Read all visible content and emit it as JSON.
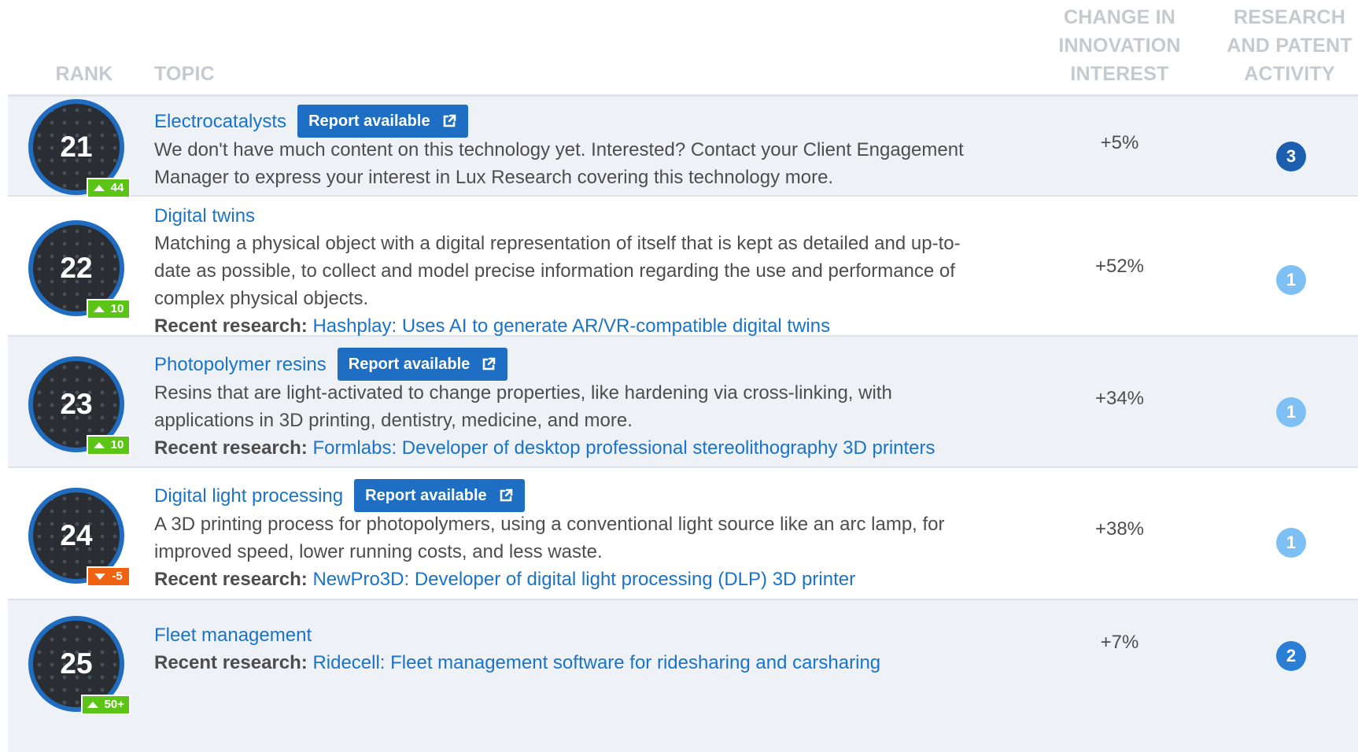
{
  "header": {
    "rank": "RANK",
    "topic": "TOPIC",
    "change": [
      "CHANGE IN",
      "INNOVATION",
      "INTEREST"
    ],
    "activity": [
      "RESEARCH",
      "AND PATENT",
      "ACTIVITY"
    ]
  },
  "rows": [
    {
      "rank": "21",
      "delta": "44",
      "delta_dir": "up",
      "title": "Electrocatalysts",
      "report": "Report available",
      "desc": [
        "We don't have much content on this technology yet. Interested? Contact your Client Engagement",
        "Manager to express your interest in Lux Research covering this technology more."
      ],
      "change": "+5%",
      "activity": "3"
    },
    {
      "rank": "22",
      "delta": "10",
      "delta_dir": "up",
      "title": "Digital twins",
      "desc": [
        "Matching a physical object with a digital representation of itself that is kept as detailed and up-to-",
        "date as possible, to collect and model precise information regarding the use and performance of",
        "complex physical objects."
      ],
      "recent_label": "Recent research:",
      "recent_link": "Hashplay: Uses AI to generate AR/VR-compatible digital twins",
      "change": "+52%",
      "activity": "1"
    },
    {
      "rank": "23",
      "delta": "10",
      "delta_dir": "up",
      "title": "Photopolymer resins",
      "report": "Report available",
      "desc": [
        "Resins that are light-activated to change properties, like hardening via cross-linking, with",
        "applications in 3D printing, dentistry, medicine, and more."
      ],
      "recent_label": "Recent research:",
      "recent_link": "Formlabs: Developer of desktop professional stereolithography 3D printers",
      "change": "+34%",
      "activity": "1"
    },
    {
      "rank": "24",
      "delta": "-5",
      "delta_dir": "down",
      "title": "Digital light processing",
      "report": "Report available",
      "desc": [
        "A 3D printing process for photopolymers, using a conventional light source like an arc lamp, for",
        "improved speed, lower running costs, and less waste."
      ],
      "recent_label": "Recent research:",
      "recent_link": "NewPro3D: Developer of digital light processing (DLP) 3D printer",
      "change": "+38%",
      "activity": "1"
    },
    {
      "rank": "25",
      "delta": "50+",
      "delta_dir": "up",
      "title": "Fleet management",
      "recent_label": "Recent research:",
      "recent_link": "Ridecell: Fleet management software for ridesharing and carsharing",
      "change": "+7%",
      "activity": "2"
    }
  ],
  "colors": {
    "link": "#1a73c8",
    "report_button": "#1e6fc4",
    "delta_up": "#5cc417",
    "delta_down": "#f0620f"
  },
  "icons": {
    "report": "external-link-icon",
    "delta_up": "triangle-up-icon",
    "delta_down": "triangle-down-icon"
  }
}
